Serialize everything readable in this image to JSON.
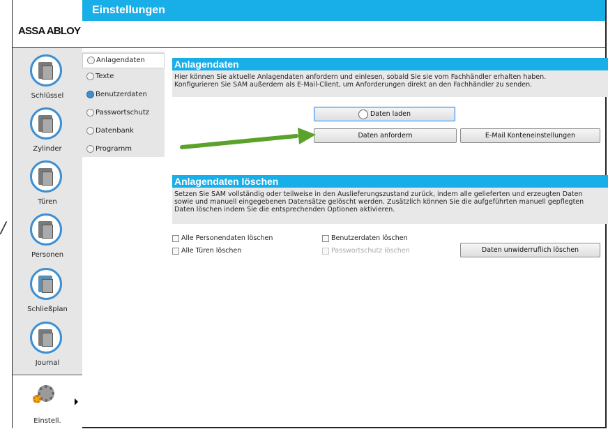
{
  "app": {
    "title": "Einstellungen",
    "logo": "ASSA ABLOY"
  },
  "nav": {
    "items": [
      {
        "label": "Schlüssel",
        "icon": "key-folder-icon"
      },
      {
        "label": "Zylinder",
        "icon": "cylinder-folder-icon"
      },
      {
        "label": "Türen",
        "icon": "door-folder-icon"
      },
      {
        "label": "Personen",
        "icon": "persons-folder-icon"
      },
      {
        "label": "Schließplan",
        "icon": "locking-plan-icon"
      },
      {
        "label": "Journal",
        "icon": "journal-folder-icon"
      },
      {
        "label": "Einstell.",
        "icon": "settings-gear-icon"
      }
    ],
    "active_index": 6
  },
  "subnav": {
    "items": [
      {
        "label": "Anlagendaten",
        "icon": "system-data-icon"
      },
      {
        "label": "Texte",
        "icon": "pencil-icon"
      },
      {
        "label": "Benutzerdaten",
        "icon": "user-icon"
      },
      {
        "label": "Passwortschutz",
        "icon": "lock-icon"
      },
      {
        "label": "Datenbank",
        "icon": "database-icon"
      },
      {
        "label": "Programm",
        "icon": "program-icon"
      }
    ],
    "selected_index": 0
  },
  "section1": {
    "title": "Anlagendaten",
    "desc1": "Hier können Sie aktuelle Anlagendaten anfordern und einlesen, sobald Sie sie vom Fachhändler erhalten haben.",
    "desc2": "Konfigurieren Sie SAM außerdem als E-Mail-Client, um Anforderungen direkt an den Fachhändler zu senden.",
    "btn_load": "Daten laden",
    "btn_request": "Daten anfordern",
    "btn_email": "E-Mail Konteneinstellungen"
  },
  "section2": {
    "title": "Anlagendaten löschen",
    "desc1": "Setzen Sie SAM vollständig oder teilweise in den Auslieferungszustand zurück, indem alle gelieferten und erzeugten Daten",
    "desc2": "sowie und manuell eingegebenen Datensätze gelöscht werden. Zusätzlich können Sie die aufgeführten manuell gepflegten",
    "desc3": "Daten löschen indem Sie die entsprechenden Optionen aktivieren.",
    "cb_persons": "Alle Personendaten löschen",
    "cb_doors": "Alle Türen löschen",
    "cb_userdata": "Benutzerdaten löschen",
    "cb_password": "Passwortschutz löschen",
    "btn_delete": "Daten unwiderruflich löschen"
  },
  "colors": {
    "accent": "#18aee8",
    "arrow": "#5aa22b"
  }
}
